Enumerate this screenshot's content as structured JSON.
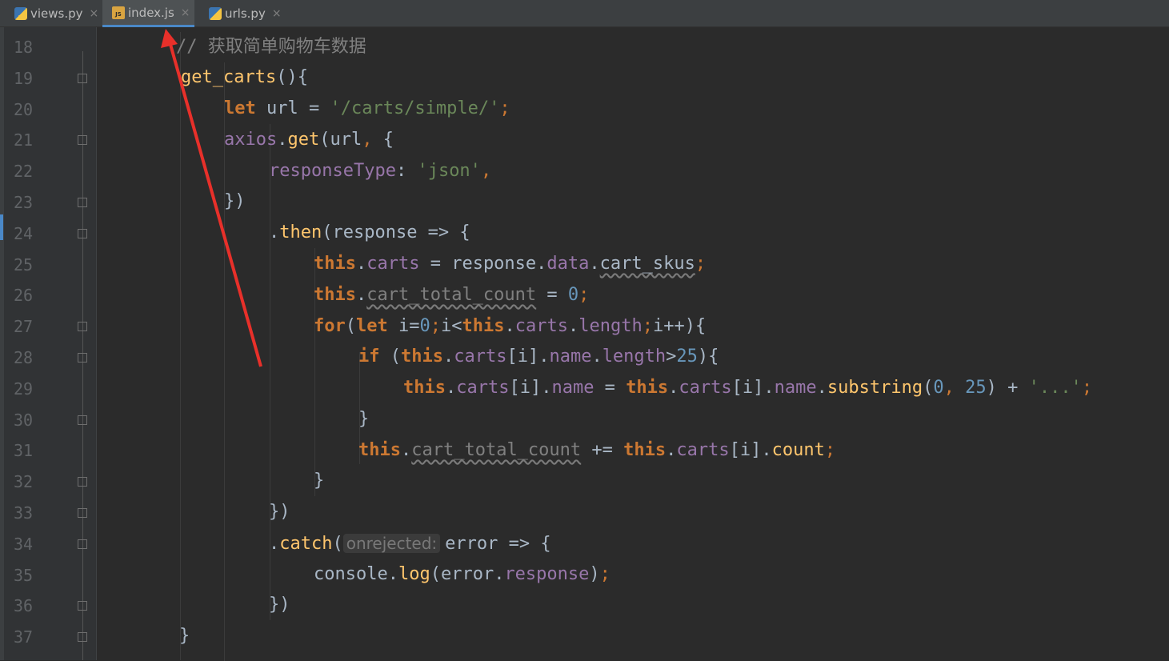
{
  "tabs": [
    {
      "label": "views.py",
      "icon": "python-file-icon",
      "active": false
    },
    {
      "label": "index.js",
      "icon": "js-file-icon",
      "active": true
    },
    {
      "label": "urls.py",
      "icon": "python-file-icon",
      "active": false
    }
  ],
  "tab_close": "×",
  "line_numbers": [
    "18",
    "19",
    "20",
    "21",
    "22",
    "23",
    "24",
    "25",
    "26",
    "27",
    "28",
    "29",
    "30",
    "31",
    "32",
    "33",
    "34",
    "35",
    "36",
    "37"
  ],
  "code": {
    "l18": {
      "comment": "// 获取简单购物车数据"
    },
    "l19": {
      "name": "get_carts",
      "rest": "(){"
    },
    "l20": {
      "kw": "let",
      "var": " url = ",
      "str": "'/carts/simple/'",
      "semi": ";"
    },
    "l21": {
      "obj": "axios",
      "dot": ".",
      "fn": "get",
      "args": "(url",
      "comma": ",",
      "brace": " {"
    },
    "l22": {
      "prop": "responseType",
      "colon": ": ",
      "str": "'json'",
      "comma": ","
    },
    "l23": {
      "text": "})"
    },
    "l24": {
      "dot": ".",
      "fn": "then",
      "rest": "(response => {"
    },
    "l25": {
      "this": "this",
      "d1": ".",
      "p1": "carts",
      "eq": " = response.",
      "p2": "data",
      "d2": ".",
      "p3": "cart_skus",
      "semi": ";"
    },
    "l26": {
      "this": "this",
      "d1": ".",
      "p1": "cart_total_count",
      "eq": " = ",
      "num": "0",
      "semi": ";"
    },
    "l27": {
      "for": "for",
      "open": "(",
      "let": "let",
      "a": " i=",
      "n0": "0",
      "s1": ";",
      "b": "i<",
      "this": "this",
      "d": ".",
      "p1": "carts",
      "d2": ".",
      "p2": "length",
      "s2": ";",
      "c": "i++){"
    },
    "l28": {
      "if": "if",
      "a": " (",
      "this": "this",
      "d": ".",
      "p1": "carts",
      "b": "[i].",
      "p2": "name",
      "d2": ".",
      "p3": "length",
      "c": ">",
      "n": "25",
      "e": "){"
    },
    "l29": {
      "this1": "this",
      "d": ".",
      "p1": "carts",
      "b": "[i].",
      "p2": "name",
      "eq": " = ",
      "this2": "this",
      "d2": ".",
      "p3": "carts",
      "c": "[i].",
      "p4": "name",
      "d3": ".",
      "fn": "substring",
      "o": "(",
      "n0": "0",
      "cm": ",",
      "sp": " ",
      "n25": "25",
      "cl": ") + ",
      "str": "'...'",
      "semi": ";"
    },
    "l30": {
      "text": "}"
    },
    "l31": {
      "this1": "this",
      "d": ".",
      "p1": "cart_total_count",
      "op": " += ",
      "this2": "this",
      "d2": ".",
      "p2": "carts",
      "b": "[i].",
      "p3": "count",
      "semi": ";"
    },
    "l32": {
      "text": "}"
    },
    "l33": {
      "text": "})"
    },
    "l34": {
      "dot": ".",
      "fn": "catch",
      "open": "(",
      "hint": "onrejected:",
      "rest": "error => {"
    },
    "l35": {
      "obj": "console",
      "d": ".",
      "fn": "log",
      "a": "(error.",
      "p": "response",
      "c": ")",
      "semi": ";"
    },
    "l36": {
      "text": "})"
    },
    "l37": {
      "text": "}"
    }
  },
  "colors": {
    "background": "#2b2b2b",
    "keyword": "#cc7832",
    "string": "#6a8759",
    "number": "#6897bb",
    "function": "#ffc66d",
    "property": "#9876aa",
    "annotation_arrow": "#e8302a"
  }
}
